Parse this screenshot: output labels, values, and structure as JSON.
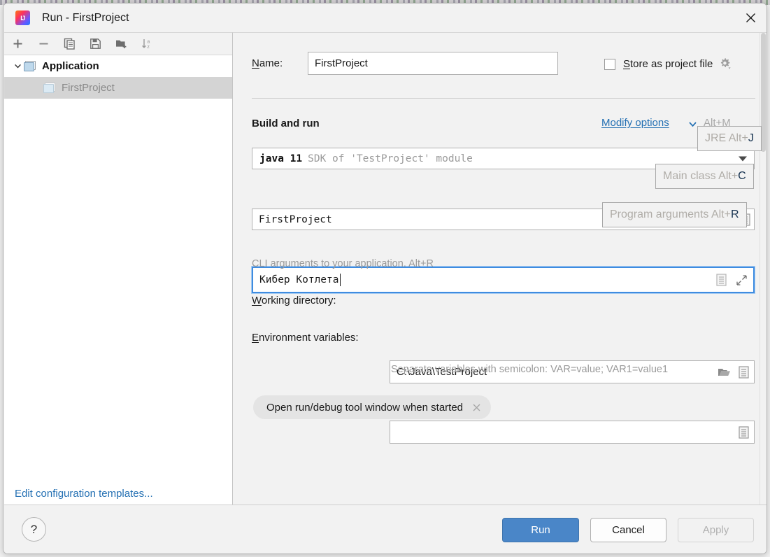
{
  "window": {
    "title": "Run - FirstProject",
    "app_icon": "intellij-idea-icon",
    "close_icon": "close-icon"
  },
  "sidebar": {
    "toolbar": [
      {
        "name": "add-configuration-button",
        "icon": "plus-icon"
      },
      {
        "name": "remove-configuration-button",
        "icon": "minus-icon"
      },
      {
        "name": "copy-configuration-button",
        "icon": "copy-icon"
      },
      {
        "name": "save-configuration-button",
        "icon": "save-icon"
      },
      {
        "name": "new-folder-button",
        "icon": "folder-add-icon"
      },
      {
        "name": "sort-configurations-button",
        "icon": "sort-alpha-icon"
      }
    ],
    "tree": {
      "group_label": "Application",
      "group_icon": "application-icon",
      "child_label": "FirstProject",
      "child_icon": "application-icon",
      "child_selected": true
    },
    "edit_templates_link": "Edit configuration templates..."
  },
  "form": {
    "name_label": "Name:",
    "name_label_mnemonic": "N",
    "name_value": "FirstProject",
    "store_as_project_file_label": "Store as project file",
    "store_as_project_file_mnemonic": "S",
    "store_as_project_file_checked": false,
    "store_gear_icon": "gear-dropdown-icon",
    "section_title": "Build and run",
    "modify_options_link": "Modify options",
    "modify_options_mnemonic": "M",
    "modify_options_shortcut": "Alt+M",
    "modify_options_chevron": "chevron-down-icon",
    "sdk": {
      "version": "java 11",
      "description": "SDK of 'TestProject' module",
      "dropdown_icon": "dropdown-arrow-icon"
    },
    "main_class": {
      "value": "FirstProject",
      "expand_icon": "list-expand-icon"
    },
    "program_arguments": {
      "value": "Кибер Котлета",
      "focused": true,
      "expand_icon": "list-expand-icon",
      "fullscreen_icon": "expand-diagonal-icon"
    },
    "program_arguments_hint": "CLI arguments to your application. Alt+R",
    "working_directory_label": "Working directory:",
    "working_directory_mnemonic": "W",
    "working_directory_value": "C:\\Java\\TestProject",
    "working_directory_browse_icon": "folder-open-icon",
    "working_directory_expand_icon": "list-expand-icon",
    "environment_variables_label": "Environment variables:",
    "environment_variables_mnemonic": "E",
    "environment_variables_value": "",
    "environment_variables_expand_icon": "list-expand-icon",
    "environment_variables_hint": "Separate variables with semicolon: VAR=value; VAR1=value1",
    "option_chip_label": "Open run/debug tool window when started",
    "option_chip_close_icon": "close-small-icon"
  },
  "shortcut_tips": [
    {
      "name": "jre-shortcut-tip",
      "prefix": "JRE Alt+",
      "key": "J"
    },
    {
      "name": "main-class-shortcut-tip",
      "prefix": "Main class Alt+",
      "key": "C"
    },
    {
      "name": "program-arguments-shortcut-tip",
      "prefix": "Program arguments Alt+",
      "key": "R"
    }
  ],
  "footer": {
    "help_label": "?",
    "run_label": "Run",
    "cancel_label": "Cancel",
    "apply_label": "Apply",
    "apply_disabled": true
  },
  "colors": {
    "accent_blue": "#4a86c8",
    "link_blue": "#2470b3",
    "focus_border": "#3f8ce0",
    "panel_bg": "#f2f2f2",
    "field_bg": "#ffffff",
    "selection_gray": "#d4d4d4",
    "hint_gray": "#9a9a9a"
  }
}
